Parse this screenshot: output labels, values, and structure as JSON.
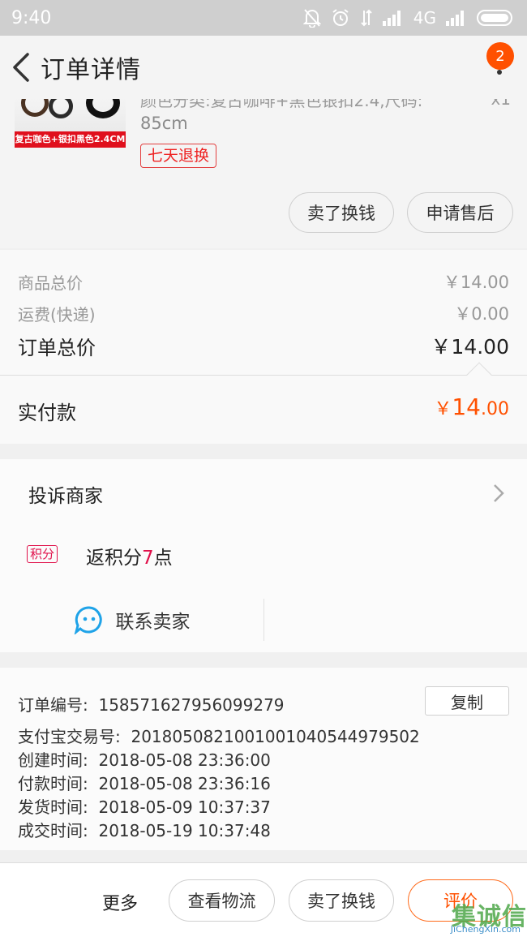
{
  "status_bar": {
    "time": "9:40",
    "network": "4G"
  },
  "nav": {
    "title": "订单详情",
    "badge_count": "2"
  },
  "product": {
    "title_partial": "颜色分类:复古咖啡+黑色银扣2.4,尺码:",
    "size": "85cm",
    "quantity": "x1",
    "thumb_caption": "复古咖色+银扣黑色2.4CM",
    "refund_tag": "七天退换",
    "buttons": [
      "卖了换钱",
      "申请售后"
    ]
  },
  "prices": {
    "goods_total_label": "商品总价",
    "goods_total": "￥14.00",
    "shipping_label": "运费(快递)",
    "shipping": "￥0.00",
    "order_total_label": "订单总价",
    "order_total": "￥14.00",
    "paid_label": "实付款",
    "paid_currency": "￥",
    "paid_int": "14",
    "paid_dec": ".00"
  },
  "actions": {
    "complain": "投诉商家",
    "points_tag": "积分",
    "points_prefix": "返积分",
    "points_num": "7",
    "points_suffix": "点",
    "contact": "联系卖家"
  },
  "order_info": {
    "order_no_label": "订单编号:",
    "order_no": "158571627956099279",
    "copy": "复制",
    "alipay_label": "支付宝交易号:",
    "alipay_no": "2018050821001001040544979502",
    "created_label": "创建时间:",
    "created": "2018-05-08 23:36:00",
    "paid_label": "付款时间:",
    "paid": "2018-05-08 23:36:16",
    "shipped_label": "发货时间:",
    "shipped": "2018-05-09 10:37:37",
    "closed_label": "成交时间:",
    "closed": "2018-05-19 10:37:48"
  },
  "bottom_bar": {
    "more": "更多",
    "logistics": "查看物流",
    "sell": "卖了换钱",
    "review": "评价"
  },
  "watermark": {
    "logo": "集诚信",
    "url": "JiChengXin.com"
  },
  "colors": {
    "accent": "#ff5000",
    "points": "#e0104a",
    "refund": "#e22222"
  }
}
